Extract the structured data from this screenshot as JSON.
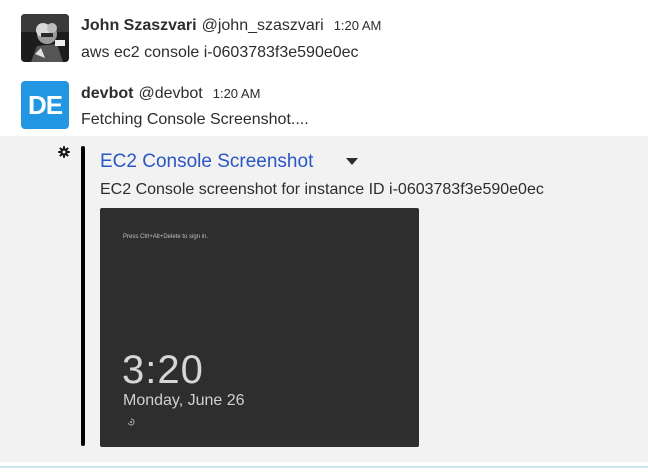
{
  "messages": [
    {
      "author": "John Szaszvari",
      "handle": "@john_szaszvari",
      "time": "1:20 AM",
      "text": "aws ec2 console i-0603783f3e590e0ec",
      "avatar": {
        "type": "photo",
        "icon": "user-photo"
      }
    },
    {
      "author": "devbot",
      "handle": "@devbot",
      "time": "1:20 AM",
      "text": "Fetching Console Screenshot....",
      "avatar": {
        "type": "initials",
        "initials": "DE",
        "color": "#2296e3"
      }
    }
  ],
  "attachment": {
    "title": "EC2 Console Screenshot",
    "description": "EC2 Console screenshot for instance ID i-0603783f3e590e0ec",
    "title_color": "#2a56c6",
    "bar_color": "#000000",
    "screenshot": {
      "hint": "Press Ctrl+Alt+Delete to sign in.",
      "clock": "3:20",
      "date": "Monday, June 26"
    }
  }
}
